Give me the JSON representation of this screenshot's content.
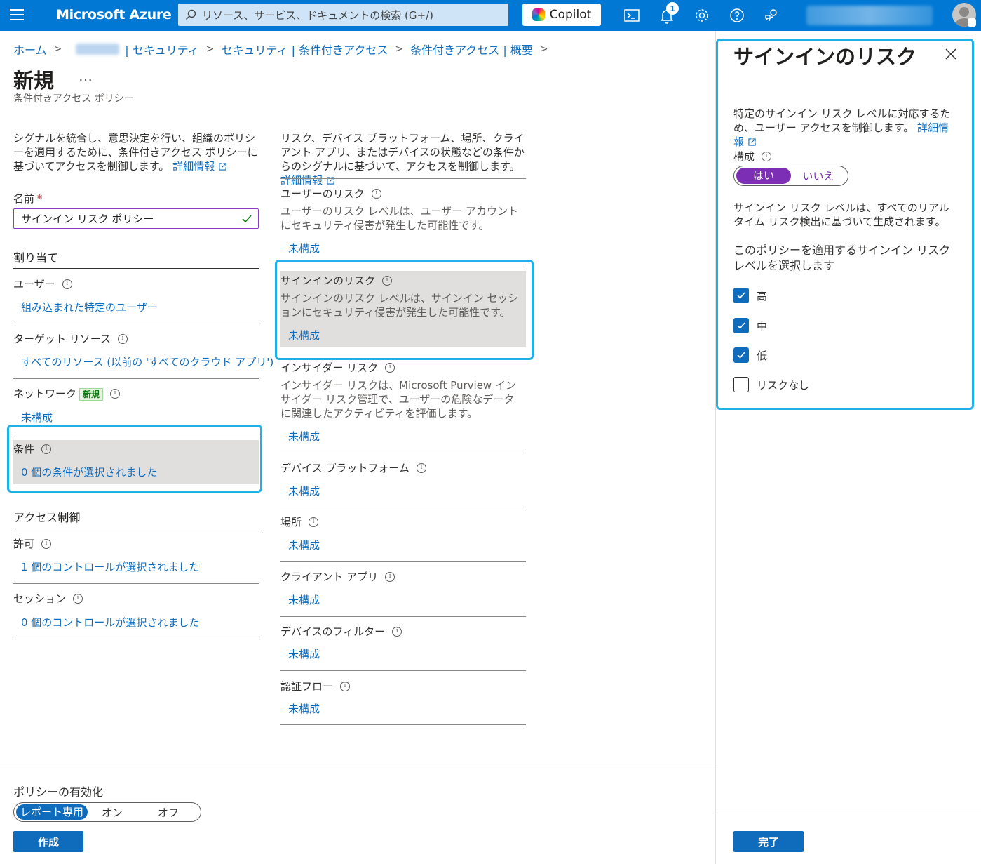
{
  "topbar": {
    "brand": "Microsoft Azure",
    "search_placeholder": "リソース、サービス、ドキュメントの検索 (G+/)",
    "copilot_label": "Copilot",
    "notification_count": "1"
  },
  "breadcrumb": {
    "items": [
      "ホーム",
      "| セキュリティ",
      "セキュリティ | 条件付きアクセス",
      "条件付きアクセス | 概要"
    ]
  },
  "page": {
    "title": "新規",
    "more": "…",
    "subtitle": "条件付きアクセス ポリシー"
  },
  "left": {
    "desc": "シグナルを統合し、意思決定を行い、組織のポリシーを適用するために、条件付きアクセス ポリシーに基づいてアクセスを制御します。",
    "desc_link": "詳細情報",
    "name_label": "名前",
    "required_mark": "*",
    "name_value": "サインイン リスク ポリシー",
    "assignments_header": "割り当て",
    "users_label": "ユーザー",
    "users_value": "組み込まれた特定のユーザー",
    "target_label": "ターゲット リソース",
    "target_value": "すべてのリソース (以前の 'すべてのクラウド アプリ')",
    "network_label": "ネットワーク",
    "network_tag": "新規",
    "network_value": "未構成",
    "conditions_label": "条件",
    "conditions_value": "0 個の条件が選択されました",
    "access_header": "アクセス制御",
    "grant_label": "許可",
    "grant_value": "1 個のコントロールが選択されました",
    "session_label": "セッション",
    "session_value": "0 個のコントロールが選択されました"
  },
  "middle": {
    "desc": "リスク、デバイス プラットフォーム、場所、クライアント アプリ、またはデバイスの状態などの条件からのシグナルに基づいて、アクセスを制御します。",
    "desc_link": "詳細情報",
    "user_risk_label": "ユーザーのリスク",
    "user_risk_desc": "ユーザーのリスク レベルは、ユーザー アカウントにセキュリティ侵害が発生した可能性です。",
    "user_risk_value": "未構成",
    "signin_risk_label": "サインインのリスク",
    "signin_risk_desc": "サインインのリスク レベルは、サインイン セッションにセキュリティ侵害が発生した可能性です。",
    "signin_risk_value": "未構成",
    "insider_label": "インサイダー リスク",
    "insider_desc": "インサイダー リスクは、Microsoft Purview インサイダー リスク管理で、ユーザーの危険なデータに関連したアクティビティを評価します。",
    "insider_value": "未構成",
    "platform_label": "デバイス プラットフォーム",
    "platform_value": "未構成",
    "location_label": "場所",
    "location_value": "未構成",
    "client_label": "クライアント アプリ",
    "client_value": "未構成",
    "filter_label": "デバイスのフィルター",
    "filter_value": "未構成",
    "authflow_label": "認証フロー",
    "authflow_value": "未構成"
  },
  "footer": {
    "enable_label": "ポリシーの有効化",
    "options": [
      "レポート専用",
      "オン",
      "オフ"
    ],
    "selected": "レポート専用",
    "create_button": "作成"
  },
  "panel": {
    "title": "サインインのリスク",
    "desc": "特定のサインイン リスク レベルに対応するため、ユーザー アクセスを制御します。",
    "desc_link": "詳細情報",
    "config_label": "構成",
    "yes": "はい",
    "no": "いいえ",
    "config_selected": "はい",
    "level_desc": "サインイン リスク レベルは、すべてのリアルタイム リスク検出に基づいて生成されます。",
    "select_prompt": "このポリシーを適用するサインイン リスク レベルを選択します",
    "levels": [
      {
        "label": "高",
        "checked": true
      },
      {
        "label": "中",
        "checked": true
      },
      {
        "label": "低",
        "checked": true
      },
      {
        "label": "リスクなし",
        "checked": false
      }
    ],
    "done_button": "完了"
  },
  "colors": {
    "azure_blue": "#0078d4",
    "link": "#0f6cbd",
    "toggle_purple": "#7c2fb5",
    "callout": "#1fb0e8"
  }
}
